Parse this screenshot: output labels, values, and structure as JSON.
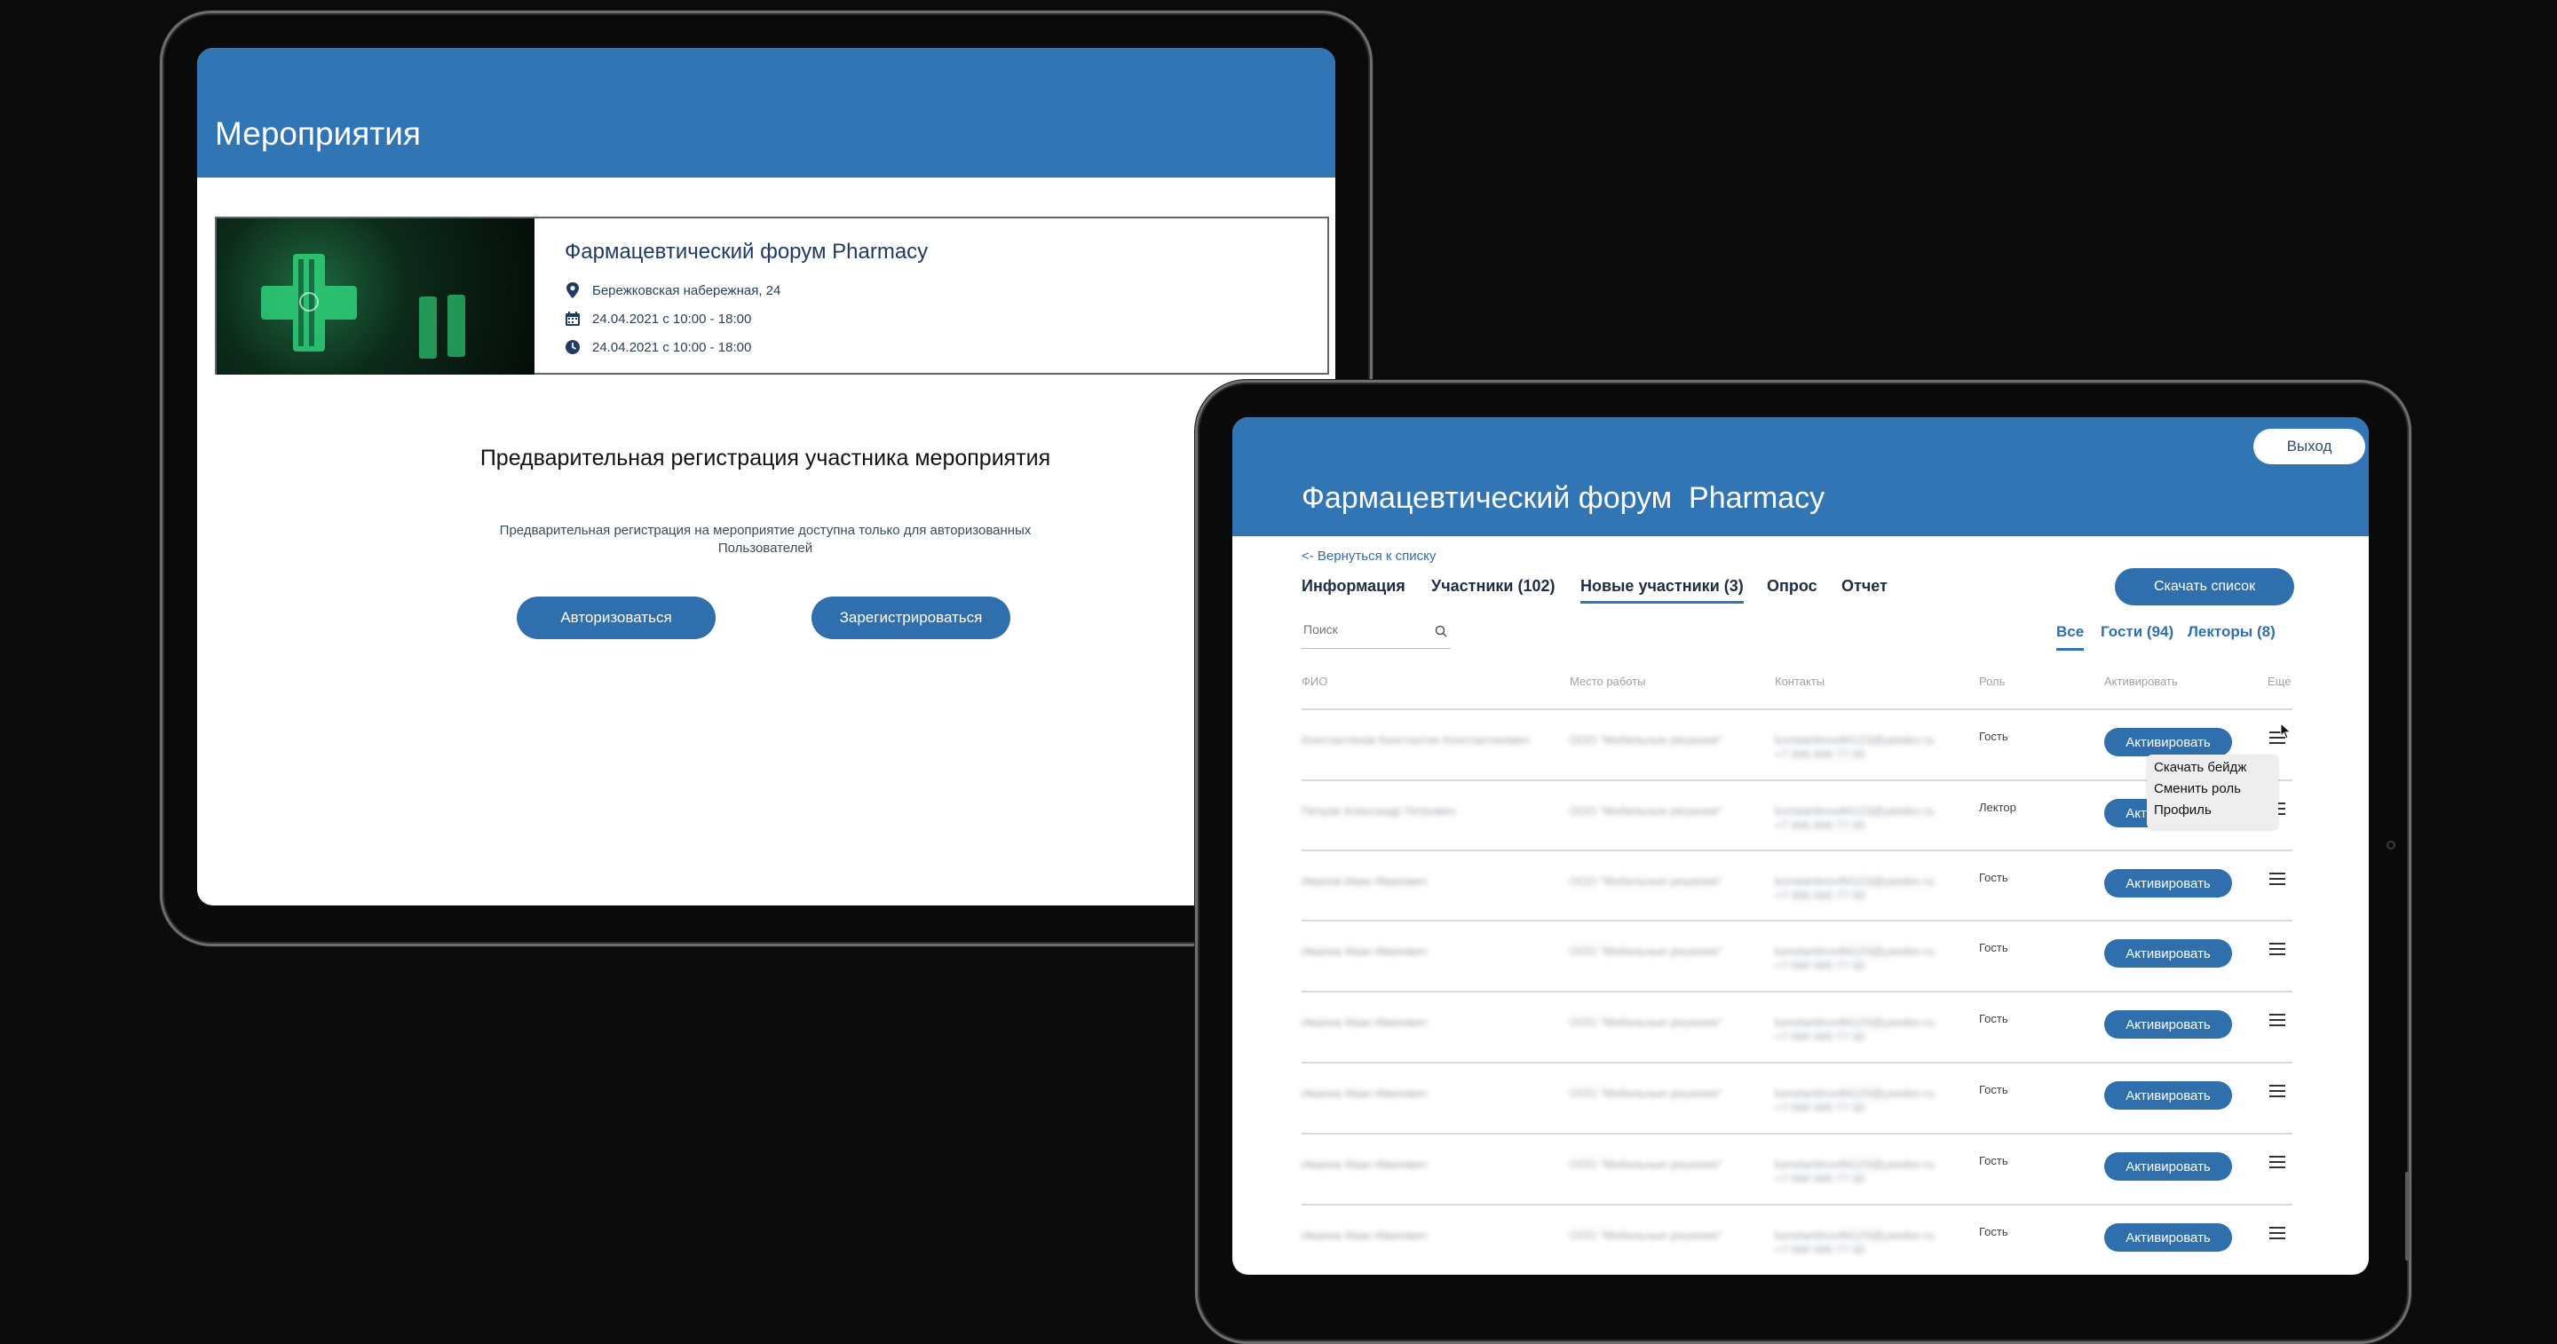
{
  "left_tablet": {
    "header_title": "Мероприятия",
    "event_title": "Фармацевтический форум Pharmacy",
    "details": [
      {
        "icon": "location-pin-icon",
        "text": "Бережковская набережная, 24"
      },
      {
        "icon": "calendar-icon",
        "text": "24.04.2021 с 10:00 - 18:00"
      },
      {
        "icon": "clock-icon",
        "text": "24.04.2021 с 10:00 - 18:00"
      }
    ],
    "section_title": "Предварительная регистрация участника мероприятия",
    "notice_line1": "Предварительная регистрация на мероприятие доступна только для авторизованных",
    "notice_line2": "Пользователей",
    "login_button": "Авторизоваться",
    "register_button": "Зарегистрироваться"
  },
  "right_tablet": {
    "logout_button": "Выход",
    "header_title": "Фармацевтический форум  Pharmacy",
    "back_link": "<- Вернуться к списку",
    "tabs": [
      "Информация",
      "Участники (102)",
      "Новые участники (3)",
      "Опрос",
      "Отчет"
    ],
    "active_tab": "Новые участники (3)",
    "download_button": "Скачать список",
    "search_placeholder": "Поиск",
    "filters": [
      "Все",
      "Гости (94)",
      "Лекторы (8)"
    ],
    "active_filter": "Все",
    "columns": [
      "ФИО",
      "Место работы",
      "Контакты",
      "Роль",
      "Активировать",
      "Еще"
    ],
    "rows": [
      {
        "name": "Константинов Константин Константинович",
        "work": "ООО \"Мобильные решения\"",
        "email": "konstantinov84123@yandex.ru",
        "phone": "+7 000 000 77 00",
        "role": "Гость",
        "action": "Активировать"
      },
      {
        "name": "Петров Александр Петрович",
        "work": "ООО \"Мобильные решения\"",
        "email": "konstantinov84123@yandex.ru",
        "phone": "+7 000 000 77 00",
        "role": "Лектор",
        "action": "Активировать"
      },
      {
        "name": "Иванов Иван Иванович",
        "work": "ООО \"Мобильные решения\"",
        "email": "konstantinov84123@yandex.ru",
        "phone": "+7 000 000 77 00",
        "role": "Гость",
        "action": "Активировать"
      },
      {
        "name": "Иванов Иван Иванович",
        "work": "ООО \"Мобильные решения\"",
        "email": "konstantinov84123@yandex.ru",
        "phone": "+7 000 000 77 00",
        "role": "Гость",
        "action": "Активировать"
      },
      {
        "name": "Иванов Иван Иванович",
        "work": "ООО \"Мобильные решения\"",
        "email": "konstantinov84123@yandex.ru",
        "phone": "+7 000 000 77 00",
        "role": "Гость",
        "action": "Активировать"
      },
      {
        "name": "Иванов Иван Иванович",
        "work": "ООО \"Мобильные решения\"",
        "email": "konstantinov84123@yandex.ru",
        "phone": "+7 000 000 77 00",
        "role": "Гость",
        "action": "Активировать"
      },
      {
        "name": "Иванов Иван Иванович",
        "work": "ООО \"Мобильные решения\"",
        "email": "konstantinov84123@yandex.ru",
        "phone": "+7 000 000 77 00",
        "role": "Гость",
        "action": "Активировать"
      },
      {
        "name": "Иванов Иван Иванович",
        "work": "ООО \"Мобильные решения\"",
        "email": "konstantinov84123@yandex.ru",
        "phone": "+7 000 000 77 00",
        "role": "Гость",
        "action": "Активировать"
      }
    ],
    "context_menu": [
      "Скачать бейдж",
      "Сменить роль",
      "Профиль"
    ]
  },
  "colors": {
    "brand_blue": "#3275b5",
    "button_blue": "#2f6fad",
    "background": "#0b0b0b"
  }
}
